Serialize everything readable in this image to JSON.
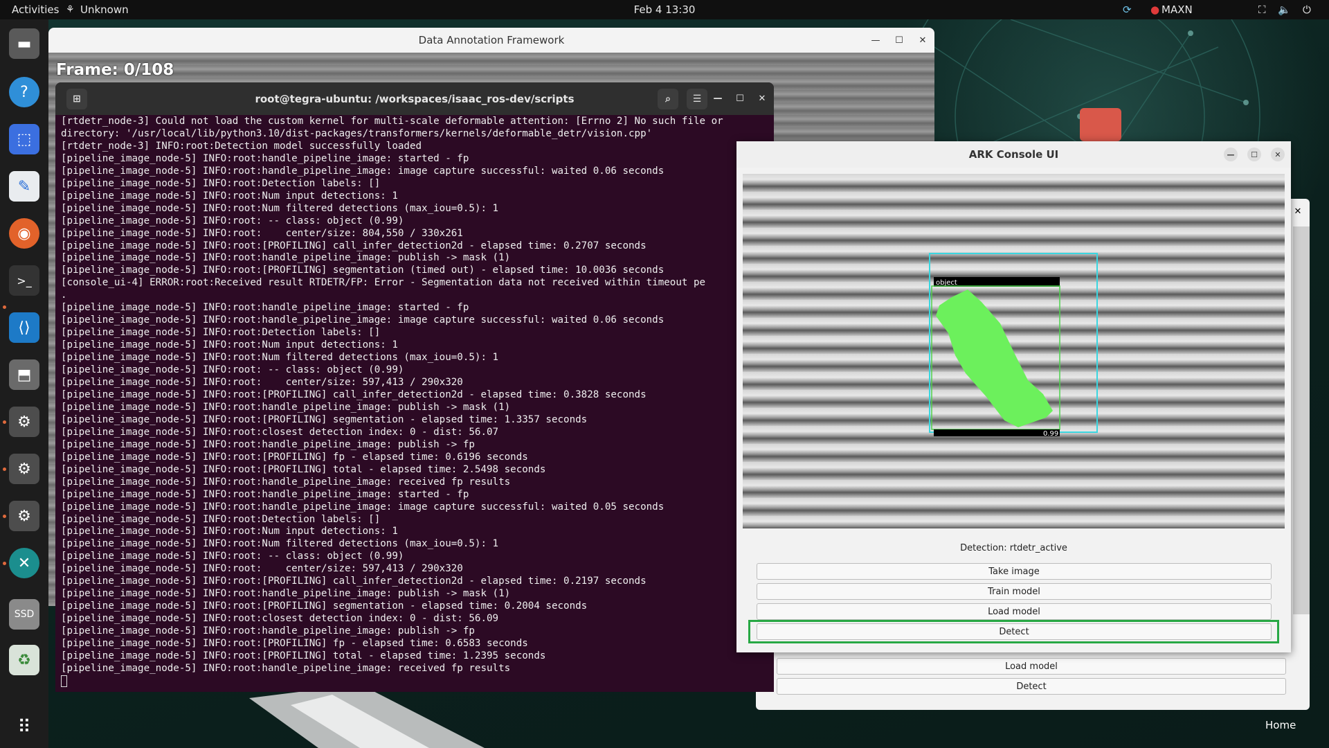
{
  "topbar": {
    "activities": "Activities",
    "app_menu": "Unknown",
    "clock": "Feb 4  13:30",
    "power_mode": "MAXN"
  },
  "dock": {
    "items": [
      {
        "name": "files-icon"
      },
      {
        "name": "help-icon"
      },
      {
        "name": "screenshot-icon"
      },
      {
        "name": "text-editor-icon"
      },
      {
        "name": "firefox-icon"
      },
      {
        "name": "terminal-icon"
      },
      {
        "name": "vscode-icon"
      },
      {
        "name": "usb-drive-icon"
      },
      {
        "name": "settings-icon"
      },
      {
        "name": "settings-icon"
      },
      {
        "name": "settings-icon"
      },
      {
        "name": "remote-desktop-icon"
      },
      {
        "name": "ssd-drive-icon"
      },
      {
        "name": "trash-icon"
      }
    ],
    "ssd_label": "SSD"
  },
  "desktop": {
    "home_label": "Home"
  },
  "daf_window": {
    "title": "Data Annotation Framework",
    "frame_label": "Frame: 0/108"
  },
  "terminal": {
    "title": "root@tegra-ubuntu: /workspaces/isaac_ros-dev/scripts",
    "lines": [
      "[rtdetr_node-3] Could not load the custom kernel for multi-scale deformable attention: [Errno 2] No such file or",
      "directory: '/usr/local/lib/python3.10/dist-packages/transformers/kernels/deformable_detr/vision.cpp'",
      "[rtdetr_node-3] INFO:root:Detection model successfully loaded",
      "[pipeline_image_node-5] INFO:root:handle_pipeline_image: started - fp",
      "[pipeline_image_node-5] INFO:root:handle_pipeline_image: image capture successful: waited 0.06 seconds",
      "[pipeline_image_node-5] INFO:root:Detection labels: []",
      "[pipeline_image_node-5] INFO:root:Num input detections: 1",
      "[pipeline_image_node-5] INFO:root:Num filtered detections (max_iou=0.5): 1",
      "[pipeline_image_node-5] INFO:root: -- class: object (0.99)",
      "[pipeline_image_node-5] INFO:root:    center/size: 804,550 / 330x261",
      "[pipeline_image_node-5] INFO:root:[PROFILING] call_infer_detection2d - elapsed time: 0.2707 seconds",
      "[pipeline_image_node-5] INFO:root:handle_pipeline_image: publish -> mask (1)",
      "[pipeline_image_node-5] INFO:root:[PROFILING] segmentation (timed out) - elapsed time: 10.0036 seconds",
      "[console_ui-4] ERROR:root:Received result RTDETR/FP: Error - Segmentation data not received within timeout pe",
      ".",
      "[pipeline_image_node-5] INFO:root:handle_pipeline_image: started - fp",
      "[pipeline_image_node-5] INFO:root:handle_pipeline_image: image capture successful: waited 0.06 seconds",
      "[pipeline_image_node-5] INFO:root:Detection labels: []",
      "[pipeline_image_node-5] INFO:root:Num input detections: 1",
      "[pipeline_image_node-5] INFO:root:Num filtered detections (max_iou=0.5): 1",
      "[pipeline_image_node-5] INFO:root: -- class: object (0.99)",
      "[pipeline_image_node-5] INFO:root:    center/size: 597,413 / 290x320",
      "[pipeline_image_node-5] INFO:root:[PROFILING] call_infer_detection2d - elapsed time: 0.3828 seconds",
      "[pipeline_image_node-5] INFO:root:handle_pipeline_image: publish -> mask (1)",
      "[pipeline_image_node-5] INFO:root:[PROFILING] segmentation - elapsed time: 1.3357 seconds",
      "[pipeline_image_node-5] INFO:root:closest detection index: 0 - dist: 56.07",
      "[pipeline_image_node-5] INFO:root:handle_pipeline_image: publish -> fp",
      "[pipeline_image_node-5] INFO:root:[PROFILING] fp - elapsed time: 0.6196 seconds",
      "[pipeline_image_node-5] INFO:root:[PROFILING] total - elapsed time: 2.5498 seconds",
      "[pipeline_image_node-5] INFO:root:handle_pipeline_image: received fp results",
      "[pipeline_image_node-5] INFO:root:handle_pipeline_image: started - fp",
      "[pipeline_image_node-5] INFO:root:handle_pipeline_image: image capture successful: waited 0.05 seconds",
      "[pipeline_image_node-5] INFO:root:Detection labels: []",
      "[pipeline_image_node-5] INFO:root:Num input detections: 1",
      "[pipeline_image_node-5] INFO:root:Num filtered detections (max_iou=0.5): 1",
      "[pipeline_image_node-5] INFO:root: -- class: object (0.99)",
      "[pipeline_image_node-5] INFO:root:    center/size: 597,413 / 290x320",
      "[pipeline_image_node-5] INFO:root:[PROFILING] call_infer_detection2d - elapsed time: 0.2197 seconds",
      "[pipeline_image_node-5] INFO:root:handle_pipeline_image: publish -> mask (1)",
      "[pipeline_image_node-5] INFO:root:[PROFILING] segmentation - elapsed time: 0.2004 seconds",
      "[pipeline_image_node-5] INFO:root:closest detection index: 0 - dist: 56.09",
      "[pipeline_image_node-5] INFO:root:handle_pipeline_image: publish -> fp",
      "[pipeline_image_node-5] INFO:root:[PROFILING] fp - elapsed time: 0.6583 seconds",
      "[pipeline_image_node-5] INFO:root:[PROFILING] total - elapsed time: 1.2395 seconds",
      "[pipeline_image_node-5] INFO:root:handle_pipeline_image: received fp results"
    ]
  },
  "ark_window": {
    "title": "ARK Console UI",
    "detection_label": "object",
    "detection_score": "0.99",
    "status": "Detection: rtdetr_active",
    "buttons": {
      "take_image": "Take image",
      "train_model": "Train model",
      "load_model": "Load model",
      "detect": "Detect"
    },
    "highlight_color": "#27a844",
    "mask_color": "#6cf05c",
    "bbox_color": "#3ad6e0"
  },
  "ark_back_window": {
    "buttons": {
      "load_model": "Load model",
      "detect": "Detect"
    }
  }
}
